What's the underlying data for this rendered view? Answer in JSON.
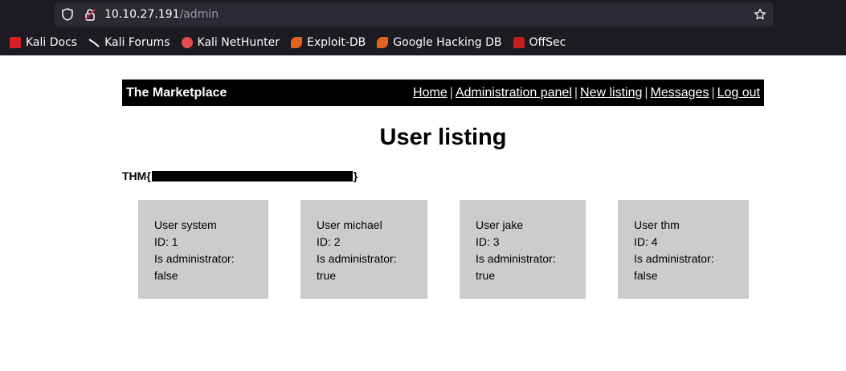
{
  "browser": {
    "url_host": "10.10.27.191",
    "url_path": "/admin",
    "bookmarks": [
      {
        "label": "Kali Docs",
        "icon": "kali-docs-icon"
      },
      {
        "label": "Kali Forums",
        "icon": "kali-forums-icon"
      },
      {
        "label": "Kali NetHunter",
        "icon": "nethunter-icon"
      },
      {
        "label": "Exploit-DB",
        "icon": "exploitdb-icon"
      },
      {
        "label": "Google Hacking DB",
        "icon": "ghdb-icon"
      },
      {
        "label": "OffSec",
        "icon": "offsec-icon"
      }
    ]
  },
  "navbar": {
    "brand": "The Marketplace",
    "links": [
      "Home",
      "Administration panel",
      "New listing",
      "Messages",
      "Log out"
    ],
    "separator": "|"
  },
  "page": {
    "title": "User listing",
    "flag_prefix": "THM{",
    "flag_suffix": "}"
  },
  "users": [
    {
      "name": "User system",
      "id": "ID: 1",
      "admin_label": "Is administrator:",
      "admin_value": "false"
    },
    {
      "name": "User michael",
      "id": "ID: 2",
      "admin_label": "Is administrator:",
      "admin_value": "true"
    },
    {
      "name": "User jake",
      "id": "ID: 3",
      "admin_label": "Is administrator:",
      "admin_value": "true"
    },
    {
      "name": "User thm",
      "id": "ID: 4",
      "admin_label": "Is administrator:",
      "admin_value": "false"
    }
  ],
  "colors": {
    "chrome_bg": "#1c1b22",
    "urlbar_bg": "#2b2a33",
    "navbar_bg": "#000000",
    "card_bg": "#cccccc"
  }
}
